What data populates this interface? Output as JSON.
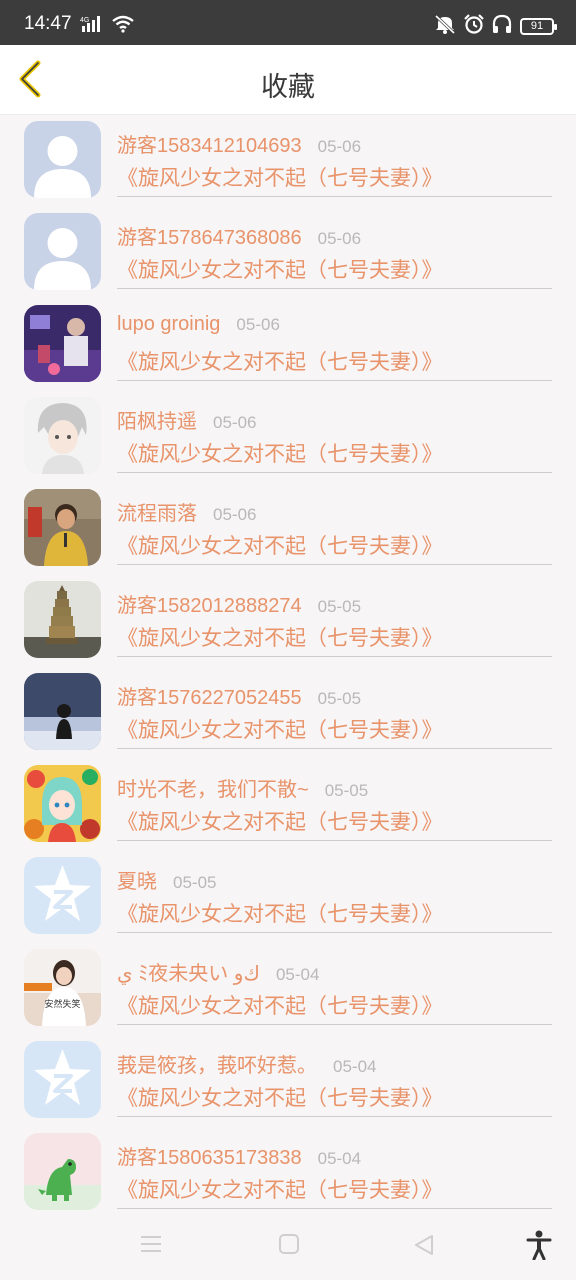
{
  "status_bar": {
    "time": "14:47",
    "network": "4G",
    "battery": "91",
    "icons": [
      "signal-icon",
      "wifi-icon",
      "mute-icon",
      "alarm-icon",
      "headphones-icon",
      "battery-icon"
    ]
  },
  "header": {
    "title": "收藏",
    "back_icon": "chevron-left-icon"
  },
  "colors": {
    "accent": "#e8936a",
    "back_icon": "#e8c400",
    "date": "#b9b9b9",
    "status_bg": "#3c3c3c",
    "default_avatar": "#c9d3e8",
    "qq_avatar": "#d7e6f6"
  },
  "favorites": [
    {
      "name": "游客1583412104693",
      "date": "05-06",
      "title": "《旋风少女之对不起（七号夫妻）》",
      "avatar": "default"
    },
    {
      "name": "游客1578647368086",
      "date": "05-06",
      "title": "《旋风少女之对不起（七号夫妻）》",
      "avatar": "default"
    },
    {
      "name": "lupo groinig",
      "date": "05-06",
      "title": "《旋风少女之对不起（七号夫妻）》",
      "avatar": "photo-purple"
    },
    {
      "name": "陌枫持遥",
      "date": "05-06",
      "title": "《旋风少女之对不起（七号夫妻）》",
      "avatar": "anime-boy"
    },
    {
      "name": "流程雨落",
      "date": "05-06",
      "title": "《旋风少女之对不起（七号夫妻）》",
      "avatar": "photo-child"
    },
    {
      "name": "游客1582012888274",
      "date": "05-05",
      "title": "《旋风少女之对不起（七号夫妻）》",
      "avatar": "photo-pagoda"
    },
    {
      "name": "游客1576227052455",
      "date": "05-05",
      "title": "《旋风少女之对不起（七号夫妻）》",
      "avatar": "photo-snow"
    },
    {
      "name": "时光不老，我们不散~",
      "date": "05-05",
      "title": "《旋风少女之对不起（七号夫妻）》",
      "avatar": "anime-girl"
    },
    {
      "name": "夏晓",
      "date": "05-05",
      "title": "《旋风少女之对不起（七号夫妻）》",
      "avatar": "qq"
    },
    {
      "name": "ي ﾐ夜未央い ﻙو",
      "date": "05-04",
      "title": "《旋风少女之对不起（七号夫妻）》",
      "avatar": "photo-woman",
      "avatar_caption": "安然失笑"
    },
    {
      "name": "莪是筱孩，莪吥好惹。",
      "date": "05-04",
      "title": "《旋风少女之对不起（七号夫妻）》",
      "avatar": "qq"
    },
    {
      "name": "游客1580635173838",
      "date": "05-04",
      "title": "《旋风少女之对不起（七号夫妻）》",
      "avatar": "dino"
    }
  ],
  "nav_bar": {
    "icons": [
      "menu-icon",
      "home-icon",
      "back-triangle-icon",
      "accessibility-icon"
    ]
  }
}
